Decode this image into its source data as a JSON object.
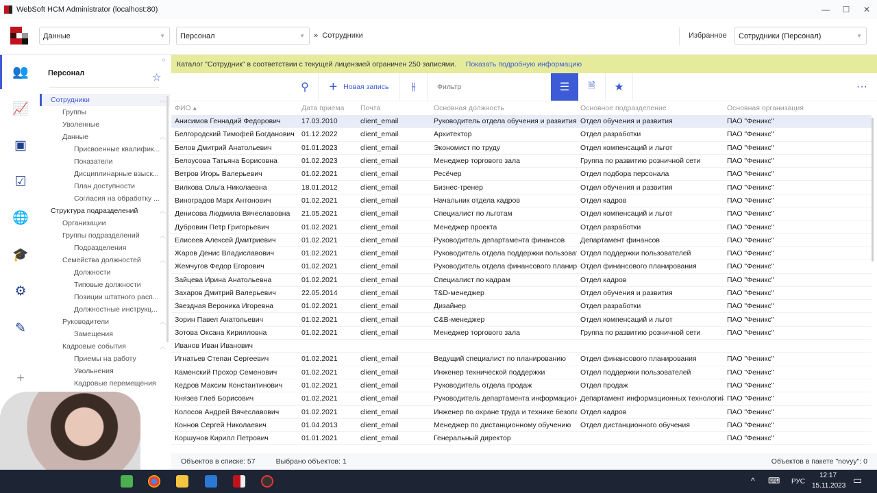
{
  "window": {
    "title": "WebSoft HCM Administrator (localhost:80)",
    "minimize": "—",
    "maximize": "☐",
    "close": "✕"
  },
  "header": {
    "section_select": "Данные",
    "catalog_select": "Персонал",
    "breadcrumb_sep": "»",
    "breadcrumb": "Сотрудники",
    "favorites_label": "Избранное",
    "favorites_select": "Сотрудники (Персонал)"
  },
  "rail": {
    "icons": [
      "people-icon",
      "chart-icon",
      "id-card-icon",
      "checklist-icon",
      "globe-icon",
      "graduation-cap-icon",
      "gear-icon",
      "brush-icon",
      "plus-icon"
    ]
  },
  "tree": {
    "title": "Персонал",
    "items": [
      {
        "label": "Сотрудники",
        "level": 0,
        "selected": true,
        "caret": true
      },
      {
        "label": "Группы",
        "level": 1
      },
      {
        "label": "Уволенные",
        "level": 1
      },
      {
        "label": "Данные",
        "level": 1,
        "caret": true
      },
      {
        "label": "Присвоенные квалифик...",
        "level": 2
      },
      {
        "label": "Показатели",
        "level": 2
      },
      {
        "label": "Дисциплинарные взыск...",
        "level": 2
      },
      {
        "label": "План доступности",
        "level": 2
      },
      {
        "label": "Согласия на обработку ...",
        "level": 2
      },
      {
        "label": "Структура подразделений",
        "level": 0,
        "caret": true
      },
      {
        "label": "Организации",
        "level": 1
      },
      {
        "label": "Группы подразделений",
        "level": 1,
        "caret": true
      },
      {
        "label": "Подразделения",
        "level": 2
      },
      {
        "label": "Семейства должностей",
        "level": 1,
        "caret": true
      },
      {
        "label": "Должности",
        "level": 2
      },
      {
        "label": "Типовые должности",
        "level": 2
      },
      {
        "label": "Позиции штатного расп...",
        "level": 2
      },
      {
        "label": "Должностные инструкц...",
        "level": 2
      },
      {
        "label": "Руководители",
        "level": 1,
        "caret": true
      },
      {
        "label": "Замещения",
        "level": 2
      },
      {
        "label": "Кадровые события",
        "level": 1,
        "caret": true
      },
      {
        "label": "Приемы на работу",
        "level": 2
      },
      {
        "label": "Увольнения",
        "level": 2
      },
      {
        "label": "Кадровые перемещения",
        "level": 2
      }
    ]
  },
  "banner": {
    "text": "Каталог \"Сотрудник\" в соответствии с текущей лицензией ограничен 250 записями.",
    "link": "Показать подробную информацию"
  },
  "toolbar": {
    "new_record": "Новая запись",
    "filter_placeholder": "Фильтр",
    "more": "···"
  },
  "table": {
    "columns": [
      "ФИО ▴",
      "Дата приема",
      "Почта",
      "Основная должность",
      "Основное подразделение",
      "Основная организация"
    ],
    "rows": [
      [
        "Анисимов Геннадий Федорович",
        "17.03.2010",
        "client_email",
        "Руководитель отдела обучения и развития",
        "Отдел обучения и развития",
        "ПАО \"Феникс\""
      ],
      [
        "Белгородский Тимофей Богданович",
        "01.12.2022",
        "client_email",
        "Архитектор",
        "Отдел разработки",
        "ПАО \"Феникс\""
      ],
      [
        "Белов Дмитрий Анатольевич",
        "01.01.2023",
        "client_email",
        "Экономист по труду",
        "Отдел компенсаций и льгот",
        "ПАО \"Феникс\""
      ],
      [
        "Белоусова Татьяна Борисовна",
        "01.02.2023",
        "client_email",
        "Менеджер торгового зала",
        "Группа по развитию розничной сети",
        "ПАО \"Феникс\""
      ],
      [
        "Ветров Игорь Валерьевич",
        "01.02.2021",
        "client_email",
        "Ресёчер",
        "Отдел подбора персонала",
        "ПАО \"Феникс\""
      ],
      [
        "Вилкова Ольга Николаевна",
        "18.01.2012",
        "client_email",
        "Бизнес-тренер",
        "Отдел обучения и развития",
        "ПАО \"Феникс\""
      ],
      [
        "Виноградов Марк Антонович",
        "01.02.2021",
        "client_email",
        "Начальник отдела кадров",
        "Отдел кадров",
        "ПАО \"Феникс\""
      ],
      [
        "Денисова Людмила Вячеславовна",
        "21.05.2021",
        "client_email",
        "Специалист по льготам",
        "Отдел компенсаций и льгот",
        "ПАО \"Феникс\""
      ],
      [
        "Дубровин Петр Григорьевич",
        "01.02.2021",
        "client_email",
        "Менеджер проекта",
        "Отдел разработки",
        "ПАО \"Феникс\""
      ],
      [
        "Елисеев Алексей Дмитриевич",
        "01.02.2021",
        "client_email",
        "Руководитель департамента финансов",
        "Департамент финансов",
        "ПАО \"Феникс\""
      ],
      [
        "Жаров Денис Владиславович",
        "01.02.2021",
        "client_email",
        "Руководитель отдела поддержки пользователей",
        "Отдел поддержки пользователей",
        "ПАО \"Феникс\""
      ],
      [
        "Жемчугов Федор Егорович",
        "01.02.2021",
        "client_email",
        "Руководитель отдела финансового планирования",
        "Отдел финансового планирования",
        "ПАО \"Феникс\""
      ],
      [
        "Зайцева Ирина Анатольевна",
        "01.02.2021",
        "client_email",
        "Специалист по кадрам",
        "Отдел кадров",
        "ПАО \"Феникс\""
      ],
      [
        "Захаров Дмитрий Валерьевич",
        "22.05.2014",
        "client_email",
        "T&D-менеджер",
        "Отдел обучения и развития",
        "ПАО \"Феникс\""
      ],
      [
        "Звездная Вероника Игоревна",
        "01.02.2021",
        "client_email",
        "Дизайнер",
        "Отдел разработки",
        "ПАО \"Феникс\""
      ],
      [
        "Зорин Павел Анатольевич",
        "01.02.2021",
        "client_email",
        "C&B-менеджер",
        "Отдел компенсаций и льгот",
        "ПАО \"Феникс\""
      ],
      [
        "Зотова Оксана Кирилловна",
        "01.02.2021",
        "client_email",
        "Менеджер торгового зала",
        "Группа по развитию розничной сети",
        "ПАО \"Феникс\""
      ],
      [
        "Иванов Иван Иванович",
        "",
        "",
        "",
        "",
        ""
      ],
      [
        "Игнатьев Степан Сергеевич",
        "01.02.2021",
        "client_email",
        "Ведущий специалист по планированию",
        "Отдел финансового планирования",
        "ПАО \"Феникс\""
      ],
      [
        "Каменский Прохор Семенович",
        "01.02.2021",
        "client_email",
        "Инженер технической поддержки",
        "Отдел поддержки пользователей",
        "ПАО \"Феникс\""
      ],
      [
        "Кедров Максим Константинович",
        "01.02.2021",
        "client_email",
        "Руководитель отдела продаж",
        "Отдел продаж",
        "ПАО \"Феникс\""
      ],
      [
        "Князев Глеб Борисович",
        "01.02.2021",
        "client_email",
        "Руководитель департамента информационных технологий",
        "Департамент информационных технологий",
        "ПАО \"Феникс\""
      ],
      [
        "Колосов Андрей Вячеславович",
        "01.02.2021",
        "client_email",
        "Инженер по охране труда и технике безопасности",
        "Отдел кадров",
        "ПАО \"Феникс\""
      ],
      [
        "Коннов Сергей Николаевич",
        "01.04.2013",
        "client_email",
        "Менеджер по дистанционному обучению",
        "Отдел дистанционного обучения",
        "ПАО \"Феникс\""
      ],
      [
        "Коршунов Кирилл Петрович",
        "01.01.2021",
        "client_email",
        "Генеральный директор",
        "",
        "ПАО \"Феникс\""
      ]
    ]
  },
  "status": {
    "count": "Объектов в списке: 57",
    "selected": "Выбрано объектов: 1",
    "package": "Объектов в пакете \"novyy\": 0"
  },
  "taskbar": {
    "lang": "РУС",
    "time": "12:17",
    "date": "15.11.2023"
  },
  "colors": {
    "accent": "#3d5bd6",
    "banner": "#e6eb9c",
    "brand": "#c0121c"
  }
}
